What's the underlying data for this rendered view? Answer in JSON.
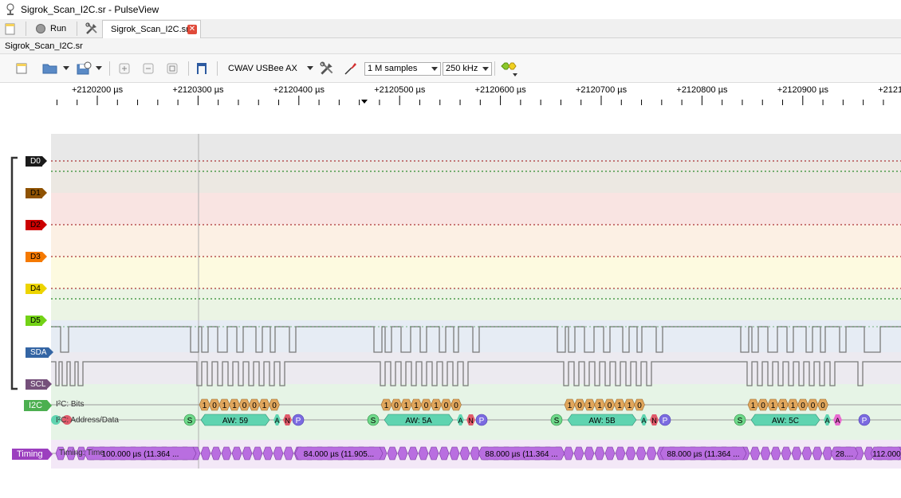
{
  "window": {
    "title": "Sigrok_Scan_I2C.sr - PulseView"
  },
  "tabs": {
    "run_label": "Run",
    "session_tab": "Sigrok_Scan_I2C.sr",
    "close_glyph": "✕"
  },
  "session": {
    "name": "Sigrok_Scan_I2C.sr"
  },
  "toolbar": {
    "device": "CWAV USBee AX",
    "samples": "1 M samples",
    "rate": "250 kHz"
  },
  "ruler": {
    "ticks": [
      "+2120200 µs",
      "+2120300 µs",
      "+2120400 µs",
      "+2120500 µs",
      "+2120600 µs",
      "+2120700 µs",
      "+2120800 µs",
      "+2120900 µs",
      "+2121"
    ]
  },
  "channels": [
    {
      "name": "D0",
      "color": "#1a1a1a",
      "text_color": "#ffffff"
    },
    {
      "name": "D1",
      "color": "#8f5202",
      "text_color": "#000000"
    },
    {
      "name": "D2",
      "color": "#cc0000",
      "text_color": "#000000"
    },
    {
      "name": "D3",
      "color": "#f57900",
      "text_color": "#000000"
    },
    {
      "name": "D4",
      "color": "#edd400",
      "text_color": "#000000"
    },
    {
      "name": "D5",
      "color": "#73d216",
      "text_color": "#000000"
    },
    {
      "name": "SDA",
      "color": "#3465a4",
      "text_color": "#ffffff"
    },
    {
      "name": "SCL",
      "color": "#75507b",
      "text_color": "#ffffff"
    }
  ],
  "decoders": {
    "i2c": {
      "label": "I2C",
      "color": "#4caf50",
      "row_bits": "I²C: Bits",
      "row_addr": "I²C: Address/Data"
    },
    "timing": {
      "label": "Timing",
      "color": "#9c3fbf",
      "row": "Timing: Time"
    }
  },
  "i2c_bits": [
    [
      "1",
      "0",
      "1",
      "1",
      "0",
      "0",
      "1",
      "0"
    ],
    [
      "1",
      "0",
      "1",
      "1",
      "0",
      "1",
      "0",
      "0"
    ],
    [
      "1",
      "0",
      "1",
      "1",
      "0",
      "1",
      "1",
      "0"
    ],
    [
      "1",
      "0",
      "1",
      "1",
      "1",
      "0",
      "0",
      "0"
    ]
  ],
  "i2c_frames": [
    {
      "start": "S",
      "addr": "AW: 59",
      "ack": "A",
      "nack": "N",
      "stop": "P"
    },
    {
      "start": "S",
      "addr": "AW: 5A",
      "ack": "A",
      "nack": "N",
      "stop": "P"
    },
    {
      "start": "S",
      "addr": "AW: 5B",
      "ack": "A",
      "nack": "N",
      "stop": "P"
    },
    {
      "start": "S",
      "addr": "AW: 5C",
      "ack": "A",
      "nack": "A",
      "stop": "P"
    }
  ],
  "timing_labels": [
    "100.000 µs (11.364 ...",
    "84.000 µs (11.905...",
    "88.000 µs (11.364 ...",
    "88.000 µs (11.364 ...",
    "28....",
    "112.000"
  ],
  "colors": {
    "accent": "#3465a4",
    "i2c_bits": "#e0a65c",
    "i2c_addr": "#5fd4b0",
    "i2c_start": "#6ed88a",
    "i2c_ack": "#5fd4b0",
    "i2c_nack": "#e05a6a",
    "i2c_stop": "#7b6be0",
    "timing": "#b96ee0"
  }
}
